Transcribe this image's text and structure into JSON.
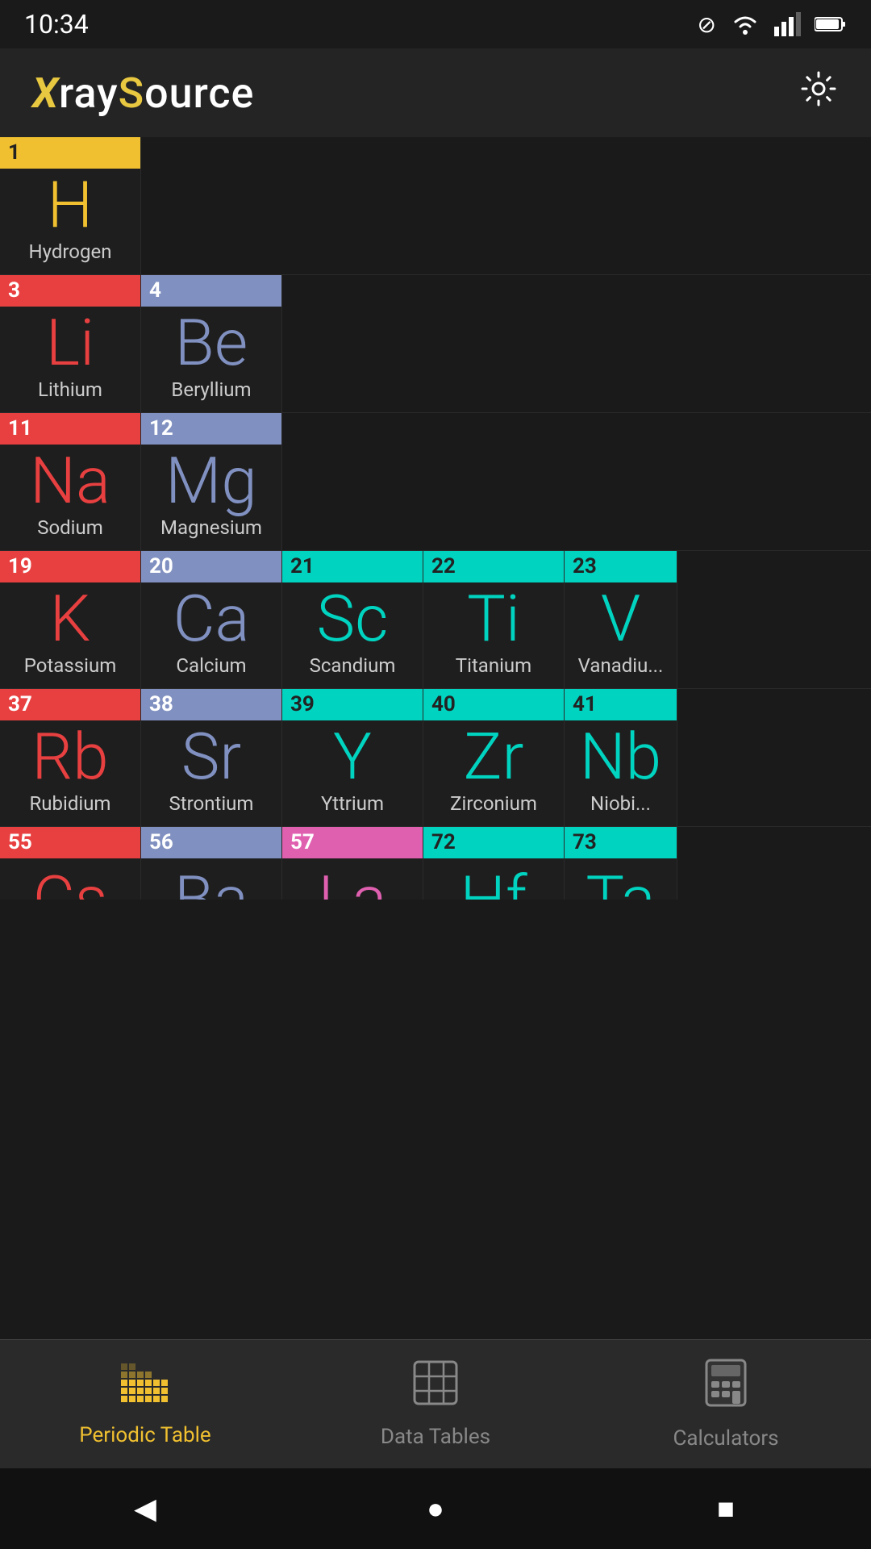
{
  "app": {
    "title_x": "X",
    "title_ray": "ray",
    "title_s": "S",
    "title_ource": "ource",
    "settings_label": "⚙"
  },
  "status": {
    "time": "10:34",
    "wifi": "📶",
    "signal": "📶",
    "battery": "🔋"
  },
  "elements": {
    "row1": [
      {
        "number": "1",
        "symbol": "H",
        "name": "Hydrogen",
        "color": "yellow",
        "colspan": 1
      }
    ],
    "row2": [
      {
        "number": "3",
        "symbol": "Li",
        "name": "Lithium",
        "color": "red"
      },
      {
        "number": "4",
        "symbol": "Be",
        "name": "Beryllium",
        "color": "blue"
      }
    ],
    "row3": [
      {
        "number": "11",
        "symbol": "Na",
        "name": "Sodium",
        "color": "red"
      },
      {
        "number": "12",
        "symbol": "Mg",
        "name": "Magnesium",
        "color": "blue"
      }
    ],
    "row4": [
      {
        "number": "19",
        "symbol": "K",
        "name": "Potassium",
        "color": "red"
      },
      {
        "number": "20",
        "symbol": "Ca",
        "name": "Calcium",
        "color": "blue"
      },
      {
        "number": "21",
        "symbol": "Sc",
        "name": "Scandium",
        "color": "cyan"
      },
      {
        "number": "22",
        "symbol": "Ti",
        "name": "Titanium",
        "color": "cyan"
      },
      {
        "number": "23",
        "symbol": "V",
        "name": "Vanadium",
        "color": "cyan"
      }
    ],
    "row5": [
      {
        "number": "37",
        "symbol": "Rb",
        "name": "Rubidium",
        "color": "red"
      },
      {
        "number": "38",
        "symbol": "Sr",
        "name": "Strontium",
        "color": "blue"
      },
      {
        "number": "39",
        "symbol": "Y",
        "name": "Yttrium",
        "color": "cyan"
      },
      {
        "number": "40",
        "symbol": "Zr",
        "name": "Zirconium",
        "color": "cyan"
      },
      {
        "number": "41",
        "symbol": "Nb",
        "name": "Niobium",
        "color": "cyan"
      }
    ],
    "row6_partial": [
      {
        "number": "55",
        "symbol": "Cs",
        "name": "",
        "color": "red"
      },
      {
        "number": "56",
        "symbol": "Ba",
        "name": "",
        "color": "blue"
      },
      {
        "number": "57",
        "symbol": "La",
        "name": "",
        "color": "pink"
      },
      {
        "number": "72",
        "symbol": "Hf",
        "name": "",
        "color": "cyan"
      },
      {
        "number": "73",
        "symbol": "Ta",
        "name": "",
        "color": "cyan"
      }
    ]
  },
  "nav": {
    "items": [
      {
        "id": "periodic-table",
        "label": "Periodic Table",
        "active": true
      },
      {
        "id": "data-tables",
        "label": "Data Tables",
        "active": false
      },
      {
        "id": "calculators",
        "label": "Calculators",
        "active": false
      }
    ]
  },
  "sys_nav": {
    "back": "◀",
    "home": "●",
    "recent": "■"
  }
}
